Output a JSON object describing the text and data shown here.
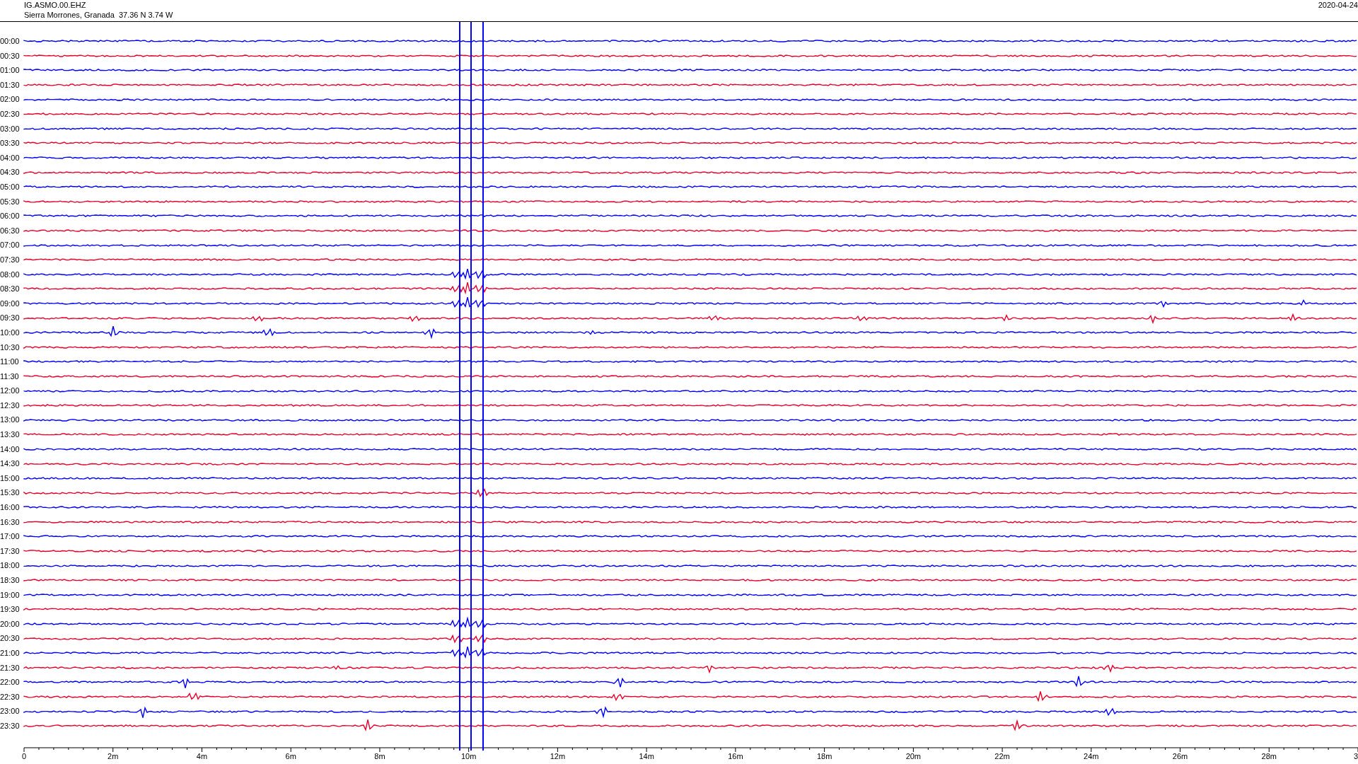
{
  "header": {
    "station": "IG.ASMO.00.EHZ",
    "location": "Sierra Morrones, Granada  37.36 N 3.74 W",
    "date": "2020-04-24"
  },
  "rows": [
    {
      "label": "00:00",
      "color": "#0000ff"
    },
    {
      "label": "00:30",
      "color": "#e8002a"
    },
    {
      "label": "01:00",
      "color": "#0000ff"
    },
    {
      "label": "01:30",
      "color": "#e8002a"
    },
    {
      "label": "02:00",
      "color": "#0000ff"
    },
    {
      "label": "02:30",
      "color": "#e8002a"
    },
    {
      "label": "03:00",
      "color": "#0000ff"
    },
    {
      "label": "03:30",
      "color": "#e8002a"
    },
    {
      "label": "04:00",
      "color": "#0000ff"
    },
    {
      "label": "04:30",
      "color": "#e8002a"
    },
    {
      "label": "05:00",
      "color": "#0000ff"
    },
    {
      "label": "05:30",
      "color": "#e8002a"
    },
    {
      "label": "06:00",
      "color": "#0000ff"
    },
    {
      "label": "06:30",
      "color": "#e8002a"
    },
    {
      "label": "07:00",
      "color": "#0000ff"
    },
    {
      "label": "07:30",
      "color": "#e8002a"
    },
    {
      "label": "08:00",
      "color": "#0000ff"
    },
    {
      "label": "08:30",
      "color": "#e8002a"
    },
    {
      "label": "09:00",
      "color": "#0000ff"
    },
    {
      "label": "09:30",
      "color": "#e8002a"
    },
    {
      "label": "10:00",
      "color": "#0000ff"
    },
    {
      "label": "10:30",
      "color": "#e8002a"
    },
    {
      "label": "11:00",
      "color": "#0000ff"
    },
    {
      "label": "11:30",
      "color": "#e8002a"
    },
    {
      "label": "12:00",
      "color": "#0000ff"
    },
    {
      "label": "12:30",
      "color": "#e8002a"
    },
    {
      "label": "13:00",
      "color": "#0000ff"
    },
    {
      "label": "13:30",
      "color": "#e8002a"
    },
    {
      "label": "14:00",
      "color": "#0000ff"
    },
    {
      "label": "14:30",
      "color": "#e8002a"
    },
    {
      "label": "15:00",
      "color": "#0000ff"
    },
    {
      "label": "15:30",
      "color": "#e8002a"
    },
    {
      "label": "16:00",
      "color": "#0000ff"
    },
    {
      "label": "16:30",
      "color": "#e8002a"
    },
    {
      "label": "17:00",
      "color": "#0000ff"
    },
    {
      "label": "17:30",
      "color": "#e8002a"
    },
    {
      "label": "18:00",
      "color": "#0000ff"
    },
    {
      "label": "18:30",
      "color": "#e8002a"
    },
    {
      "label": "19:00",
      "color": "#0000ff"
    },
    {
      "label": "19:30",
      "color": "#e8002a"
    },
    {
      "label": "20:00",
      "color": "#0000ff"
    },
    {
      "label": "20:30",
      "color": "#e8002a"
    },
    {
      "label": "21:00",
      "color": "#0000ff"
    },
    {
      "label": "21:30",
      "color": "#e8002a"
    },
    {
      "label": "22:00",
      "color": "#0000ff"
    },
    {
      "label": "22:30",
      "color": "#e8002a"
    },
    {
      "label": "23:00",
      "color": "#0000ff"
    },
    {
      "label": "23:30",
      "color": "#e8002a"
    }
  ],
  "x_axis": {
    "ticks": [
      "0",
      "2m",
      "4m",
      "6m",
      "8m",
      "10m",
      "12m",
      "14m",
      "16m",
      "18m",
      "20m",
      "22m",
      "24m",
      "26m",
      "28m",
      "3"
    ]
  }
}
